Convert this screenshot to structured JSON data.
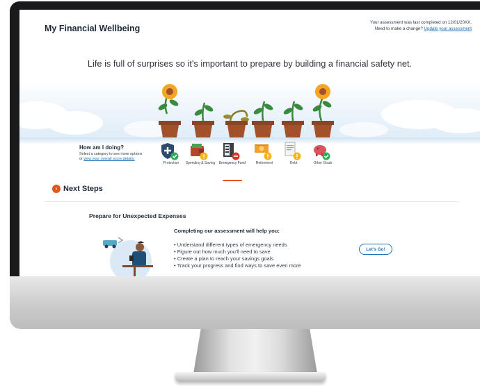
{
  "header": {
    "title": "My Financial Wellbeing",
    "assessment_note": "Your assessment was last completed on 12/01/20XX.",
    "change_prompt": "Need to make a change?",
    "update_link": "Update your assessment"
  },
  "tagline": "Life is full of surprises so it's important to prepare by building a financial safety net.",
  "how_doing": {
    "title": "How am I doing?",
    "subtitle": "Select a category to see more options",
    "or_text": "or",
    "score_link": "view your overall score details:"
  },
  "categories": [
    {
      "label": "Protection",
      "icon": "shield-icon",
      "status": "good"
    },
    {
      "label": "Spending & Saving",
      "icon": "wallet-icon",
      "status": "caution"
    },
    {
      "label": "Emergency Fund",
      "icon": "safe-icon",
      "status": "alert",
      "selected": true
    },
    {
      "label": "Retirement",
      "icon": "money-icon",
      "status": "caution"
    },
    {
      "label": "Debt",
      "icon": "document-icon",
      "status": "caution"
    },
    {
      "label": "Other Goals",
      "icon": "piggy-bank-icon",
      "status": "good"
    }
  ],
  "status_colors": {
    "good": "#2fae5a",
    "caution": "#f2b61b",
    "alert": "#d9342b"
  },
  "next_steps": {
    "title": "Next Steps",
    "section_title": "Prepare for Unexpected Expenses",
    "lead": "Completing our assessment will help you:",
    "benefits": [
      "Understand different types of emergency needs",
      "Figure out how much you'll need to save",
      "Create a plan to reach your savings goals",
      "Track your progress and find ways to save even more"
    ],
    "cta": "Let's Go!"
  },
  "colors": {
    "accent": "#e2551b",
    "link": "#1d6fb8",
    "pot": "#a3512b",
    "leaf": "#3a8a3f",
    "flower": "#f4a521"
  }
}
